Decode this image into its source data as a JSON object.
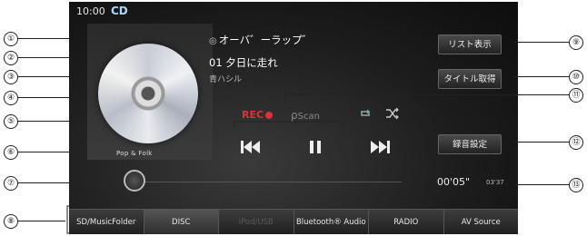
{
  "status": {
    "time": "10:00",
    "source": "CD"
  },
  "track": {
    "artist": "オーバ゛ーラップ゛",
    "title_number": "01",
    "title": "夕日に走れ",
    "album": "青ハシル",
    "genre": "Pop & Folk"
  },
  "buttons": {
    "list": "リスト表示",
    "title_fetch": "タイトル取得",
    "rec_settings": "録音設定"
  },
  "rec": {
    "label": "REC"
  },
  "scan": {
    "label": "Scan"
  },
  "playback": {
    "elapsed": "00'05\"",
    "total": "03'37",
    "progress": 0.02
  },
  "tabs": [
    {
      "label": "SD/MusicFolder",
      "state": "normal"
    },
    {
      "label": "DISC",
      "state": "active"
    },
    {
      "label": "iPod/USB",
      "state": "disabled"
    },
    {
      "label": "Bluetooth® Audio",
      "state": "normal"
    },
    {
      "label": "RADIO",
      "state": "normal"
    },
    {
      "label": "AV Source",
      "state": "normal"
    }
  ],
  "callouts": {
    "c1": "①",
    "c2": "②",
    "c3": "③",
    "c4": "④",
    "c5": "⑤",
    "c6": "⑥",
    "c7": "⑦",
    "c8": "⑧",
    "c9": "⑨",
    "c10": "⑩",
    "c11": "⑪",
    "c12": "⑫",
    "c13": "⑬"
  },
  "colors": {
    "rec": "#e0303a",
    "source": "#a8d8ff",
    "screen_bg": "#1d1d1d"
  },
  "icons": {
    "prev": "skip-previous-icon",
    "play_pause": "pause-icon",
    "next": "skip-next-icon",
    "repeat": "repeat-icon",
    "shuffle": "shuffle-icon",
    "scan": "scan-icon",
    "disc": "disc-icon"
  }
}
